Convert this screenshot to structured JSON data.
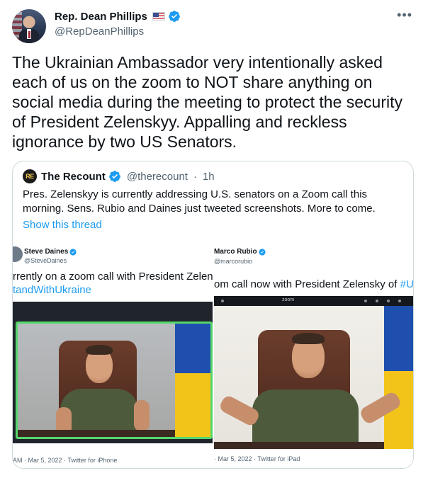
{
  "author": {
    "display_name": "Rep. Dean Phillips",
    "handle": "@RepDeanPhillips",
    "avatar_icon": "avatar-photo",
    "verified_icon": "verified-badge-icon",
    "flag_icon": "us-flag-icon"
  },
  "tweet": {
    "text": "The Ukrainian Ambassador very intentionally asked each of us on the zoom to NOT share anything on social media during the meeting to protect the security of President Zelenskyy. Appalling and reckless ignorance by two US Senators.",
    "more_icon": "more-options-icon"
  },
  "quote": {
    "logo_text": "RE",
    "name": "The Recount",
    "handle": "@therecount",
    "separator": "·",
    "time": "1h",
    "text": "Pres. Zelenskyy is currently addressing U.S. senators on a Zoom call this morning. Sens. Rubio and Daines just tweeted screenshots. More to come.",
    "show_thread": "Show this thread"
  },
  "screenshots": {
    "left": {
      "name": "Steve Daines",
      "handle": "@SteveDaines",
      "text": "rrently on a zoom call with President Zelenskyy.",
      "hashtag": "tandWithUkraine",
      "footer": "AM · Mar 5, 2022 · Twitter for iPhone"
    },
    "right": {
      "name": "Marco Rubio",
      "handle": "@marcorubio",
      "text": "om call now with President Zelensky of ",
      "hashtag": "#Uk",
      "footer": "· Mar 5, 2022 · Twitter for iPad",
      "zoom_label": "zoom"
    }
  },
  "colors": {
    "accent": "#1d9bf0",
    "text_primary": "#0f1419",
    "text_secondary": "#536471",
    "border": "#cfd9de"
  }
}
